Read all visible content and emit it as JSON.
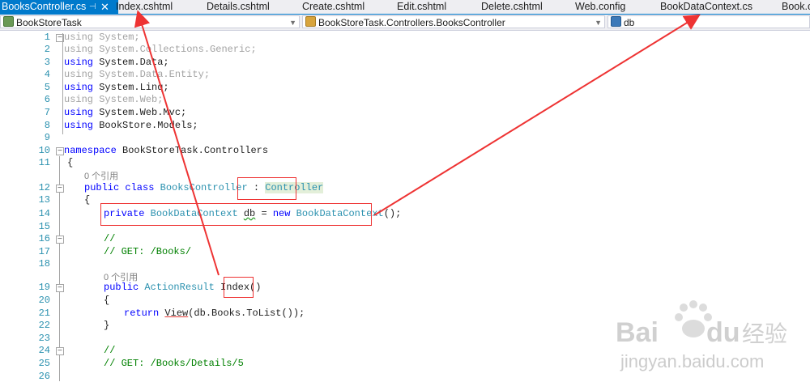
{
  "tabs": [
    {
      "label": "BooksController.cs",
      "active": true
    },
    {
      "label": "Index.cshtml"
    },
    {
      "label": "Details.cshtml"
    },
    {
      "label": "Create.cshtml"
    },
    {
      "label": "Edit.cshtml"
    },
    {
      "label": "Delete.cshtml"
    },
    {
      "label": "Web.config"
    },
    {
      "label": "BookDataContext.cs"
    },
    {
      "label": "Book.cs"
    }
  ],
  "tab_pin_glyph": "⊣",
  "tab_close_glyph": "✕",
  "nav": {
    "project": "BookStoreTask",
    "type": "BookStoreTask.Controllers.BooksController",
    "member": "db"
  },
  "editor": {
    "line_numbers": [
      "1",
      "2",
      "3",
      "4",
      "5",
      "6",
      "7",
      "8",
      "9",
      "10",
      "11",
      "12",
      "13",
      "14",
      "15",
      "16",
      "17",
      "18",
      "19",
      "20",
      "21",
      "22",
      "23",
      "24",
      "25",
      "26"
    ],
    "code": {
      "l1_kw": "using",
      "l1_ns": " System;",
      "l2_kw": "using",
      "l2_ns": " System.Collections.Generic;",
      "l3_kw": "using",
      "l3_ns": " System.Data;",
      "l4_kw": "using",
      "l4_ns": " System.Data.Entity;",
      "l5_kw": "using",
      "l5_ns": " System.Linq;",
      "l6_kw": "using",
      "l6_ns": " System.Web;",
      "l7_kw": "using",
      "l7_ns": " System.Web.Mvc;",
      "l8_kw": "using",
      "l8_ns": " BookStore.Models;",
      "l10_kw": "namespace",
      "l10_ns": " BookStoreTask.Controllers",
      "l11": "{",
      "ref1": "0 个引用",
      "l12_kw": "public class",
      "l12_name": " BooksController",
      "l12_colon": " : ",
      "l12_base": "Controller",
      "l13": "{",
      "l14_kw": "private",
      "l14_type": " BookDataContext",
      "l14_sp": " ",
      "l14_var": "db",
      "l14_eq": " = ",
      "l14_new": "new",
      "l14_type2": " BookDataContext",
      "l14_end": "();",
      "l16": "//",
      "l17": "// GET: /Books/",
      "ref2": "0 个引用",
      "l19_kw": "public",
      "l19_type": " ActionResult",
      "l19_sp": " ",
      "l19_name": "Index()",
      "l20": "{",
      "l21_kw": "return",
      "l21_sp": " ",
      "l21_view": "View",
      "l21_rest": "(db.Books.ToList());",
      "l22": "}",
      "l24": "//",
      "l25": "// GET: /Books/Details/5"
    }
  },
  "watermark": {
    "brand": "Bai",
    "brand2": "du",
    "brand_cn": "经验",
    "url": "jingyan.baidu.com"
  },
  "colors": {
    "accent": "#007acc",
    "annotation": "#ee3333",
    "keyword": "#0000ff",
    "type": "#2b91af",
    "comment": "#008000"
  }
}
